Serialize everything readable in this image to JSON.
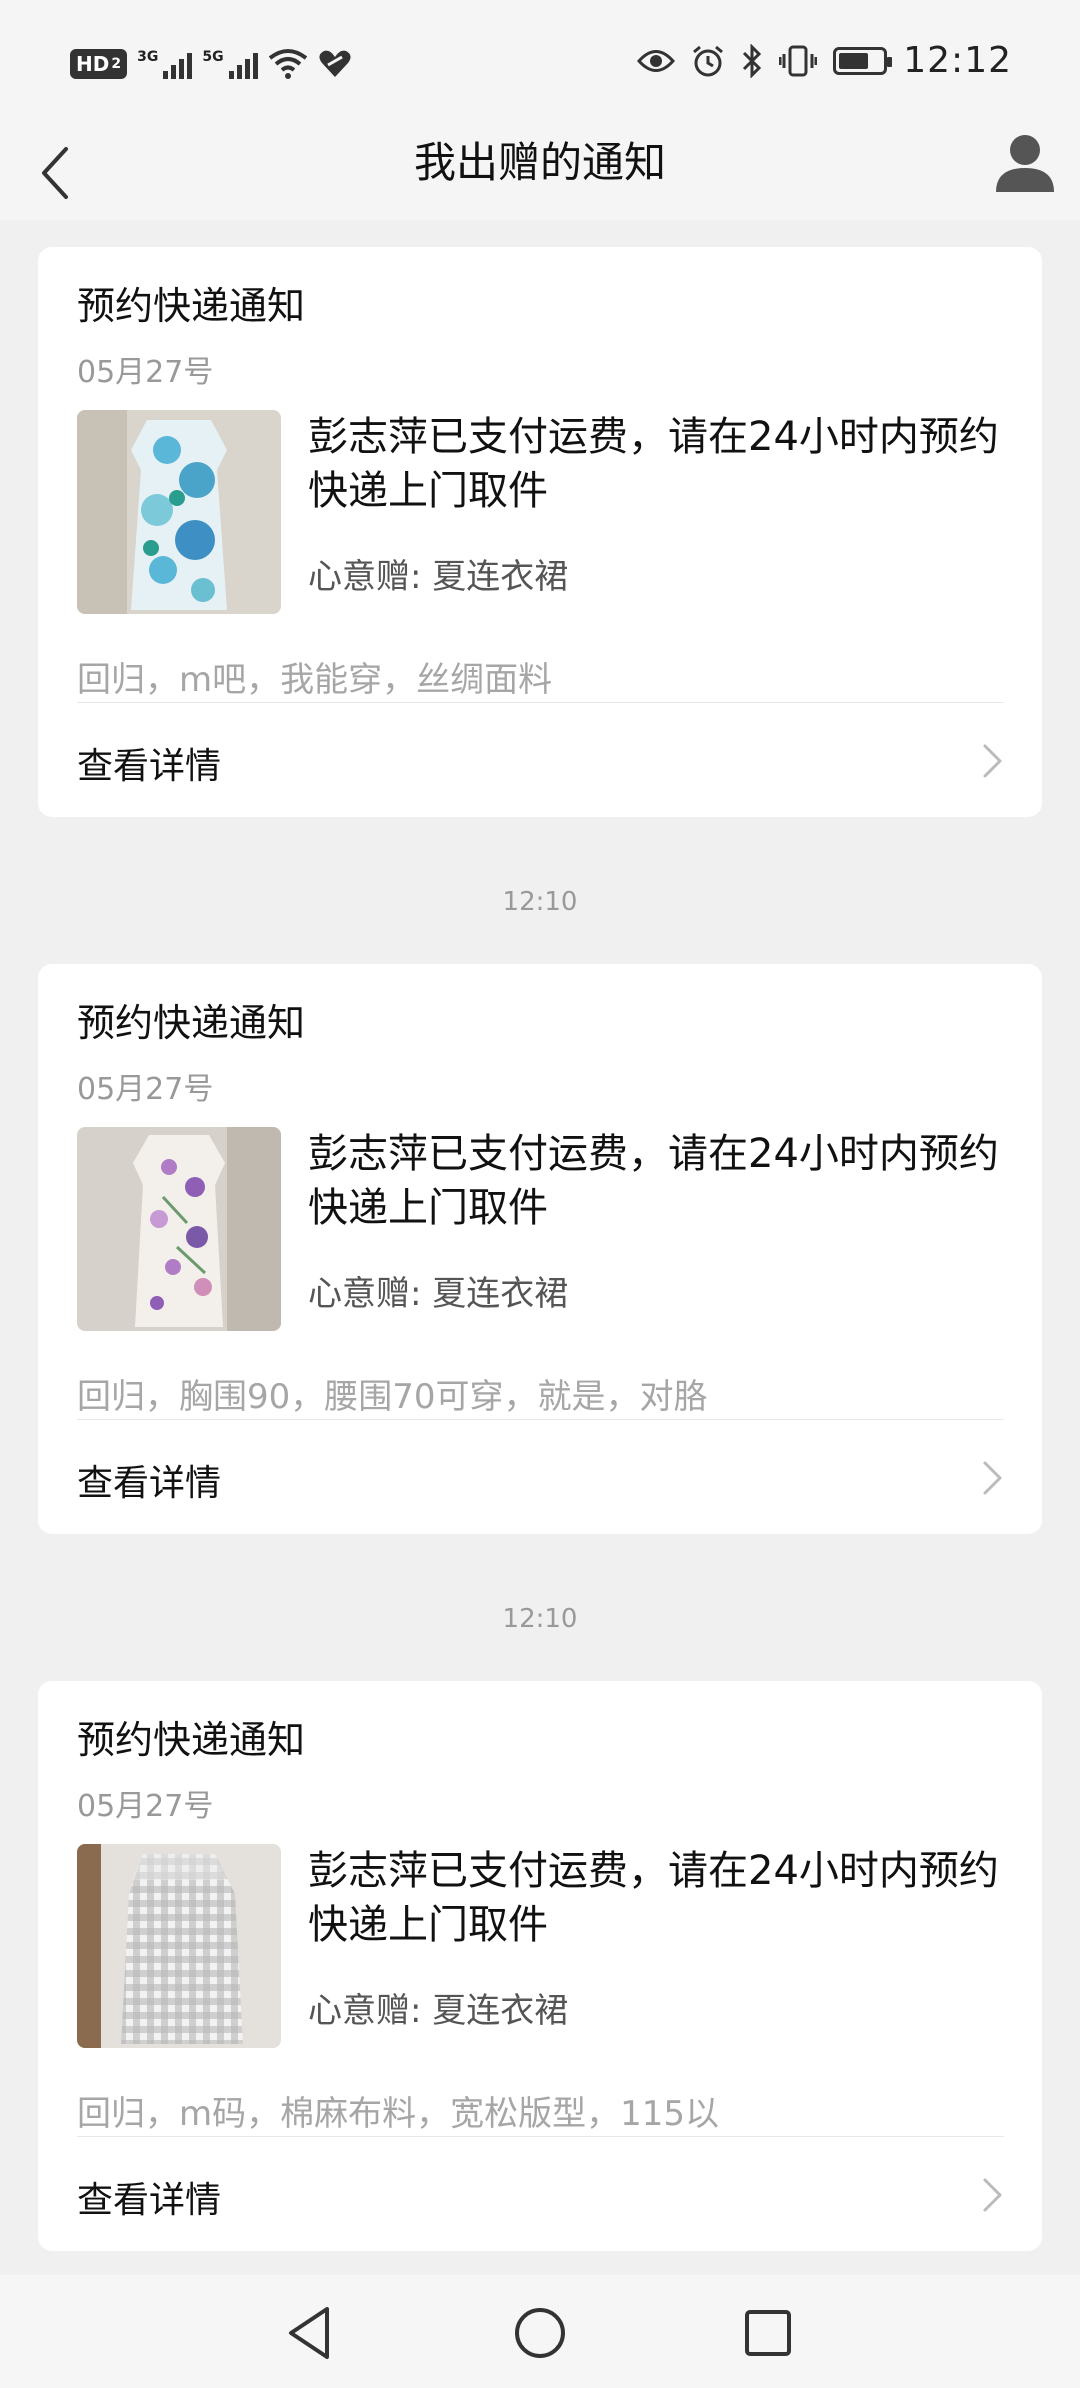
{
  "status_bar": {
    "hd": "HD",
    "hd_sub": "2",
    "sig1_label": "3G",
    "sig2_label": "5G",
    "time": "12:12",
    "battery_level": 0.7
  },
  "header": {
    "title": "我出赠的通知"
  },
  "cards": [
    {
      "title": "预约快递通知",
      "date": "05月27号",
      "message": "彭志萍已支付运费，请在24小时内预约快递上门取件",
      "gift": "心意赠: 夏连衣裙",
      "description": "回归，m吧，我能穿，丝绸面料",
      "detail_label": "查看详情",
      "thumb": "blue-floral-dress"
    },
    {
      "title": "预约快递通知",
      "date": "05月27号",
      "message": "彭志萍已支付运费，请在24小时内预约快递上门取件",
      "gift": "心意赠: 夏连衣裙",
      "description": "回归，胸围90，腰围70可穿，就是，对胳",
      "detail_label": "查看详情",
      "thumb": "white-floral-dress"
    },
    {
      "title": "预约快递通知",
      "date": "05月27号",
      "message": "彭志萍已支付运费，请在24小时内预约快递上门取件",
      "gift": "心意赠: 夏连衣裙",
      "description": "回归，m码，棉麻布料，宽松版型，115以",
      "detail_label": "查看详情",
      "thumb": "gingham-dress"
    }
  ],
  "separators": [
    "12:10",
    "12:10"
  ],
  "colors": {
    "background": "#f0f0f0",
    "card": "#ffffff",
    "secondary_text": "#999999"
  }
}
